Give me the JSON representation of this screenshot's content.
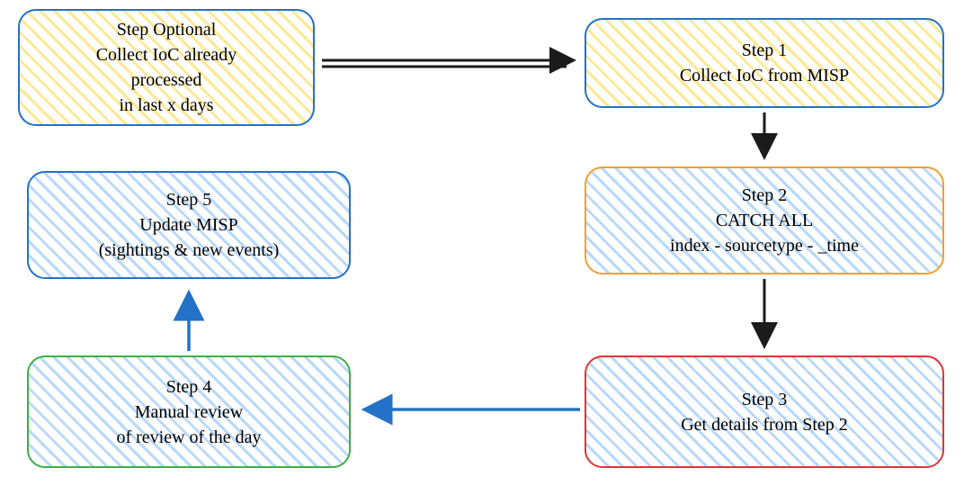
{
  "nodes": {
    "optional": {
      "line1": "Step Optional",
      "line2": "Collect IoC already",
      "line3": "processed",
      "line4": "in last x days"
    },
    "step1": {
      "line1": "Step 1",
      "line2": "Collect IoC from MISP"
    },
    "step2": {
      "line1": "Step 2",
      "line2": "CATCH ALL",
      "line3": "index - sourcetype - _time"
    },
    "step3": {
      "line1": "Step 3",
      "line2": "Get details from Step 2"
    },
    "step4": {
      "line1": "Step 4",
      "line2": "Manual review",
      "line3": "of review of the day"
    },
    "step5": {
      "line1": "Step 5",
      "line2": "Update MISP",
      "line3": "(sightings & new events)"
    }
  },
  "colors": {
    "blue": "#2372c8",
    "orange": "#f0a030",
    "red": "#e03535",
    "green": "#3cb043",
    "black": "#1b1b1b"
  },
  "flow": [
    {
      "from": "optional",
      "to": "step1",
      "style": "double-black"
    },
    {
      "from": "step1",
      "to": "step2",
      "style": "black"
    },
    {
      "from": "step2",
      "to": "step3",
      "style": "black"
    },
    {
      "from": "step3",
      "to": "step4",
      "style": "blue"
    },
    {
      "from": "step4",
      "to": "step5",
      "style": "blue"
    }
  ]
}
